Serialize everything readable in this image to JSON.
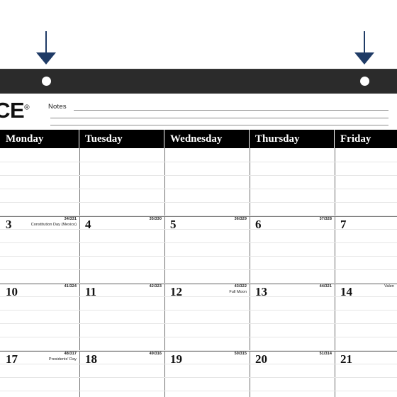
{
  "annotations": {
    "arrows": [
      {
        "name": "annotation-arrow-left",
        "direction": "down",
        "color": "#1f3b66"
      },
      {
        "name": "annotation-arrow-right",
        "direction": "down",
        "color": "#1f3b66"
      }
    ]
  },
  "binder": {
    "bar_color": "#2b2b2b",
    "holes": [
      {
        "name": "binder-hole-left"
      },
      {
        "name": "binder-hole-right"
      }
    ]
  },
  "masthead": {
    "brand": "ICE",
    "brand_mark": "®",
    "notes_label": "Notes",
    "rule_count": 3
  },
  "calendar": {
    "weekday_headers": [
      "Monday",
      "Tuesday",
      "Wednesday",
      "Thursday",
      "Friday"
    ],
    "weeks": [
      {
        "days": [
          {
            "number": "",
            "code": "",
            "event": ""
          },
          {
            "number": "",
            "code": "",
            "event": ""
          },
          {
            "number": "",
            "code": "",
            "event": ""
          },
          {
            "number": "",
            "code": "",
            "event": ""
          },
          {
            "number": "",
            "code": "",
            "event": ""
          }
        ]
      },
      {
        "days": [
          {
            "number": "3",
            "code": "34/331",
            "event": "Constitution Day (Mexico)"
          },
          {
            "number": "4",
            "code": "35/330",
            "event": ""
          },
          {
            "number": "5",
            "code": "36/329",
            "event": ""
          },
          {
            "number": "6",
            "code": "37/328",
            "event": ""
          },
          {
            "number": "7",
            "code": "",
            "event": ""
          }
        ]
      },
      {
        "days": [
          {
            "number": "10",
            "code": "41/324",
            "event": ""
          },
          {
            "number": "11",
            "code": "42/323",
            "event": ""
          },
          {
            "number": "12",
            "code": "43/322",
            "event": "Full Moon"
          },
          {
            "number": "13",
            "code": "44/321",
            "event": ""
          },
          {
            "number": "14",
            "code": "",
            "event": "Valen"
          }
        ]
      },
      {
        "days": [
          {
            "number": "17",
            "code": "48/317",
            "event": "Presidents' Day"
          },
          {
            "number": "18",
            "code": "49/316",
            "event": ""
          },
          {
            "number": "19",
            "code": "50/315",
            "event": ""
          },
          {
            "number": "20",
            "code": "51/314",
            "event": ""
          },
          {
            "number": "21",
            "code": "",
            "event": ""
          }
        ]
      }
    ]
  }
}
